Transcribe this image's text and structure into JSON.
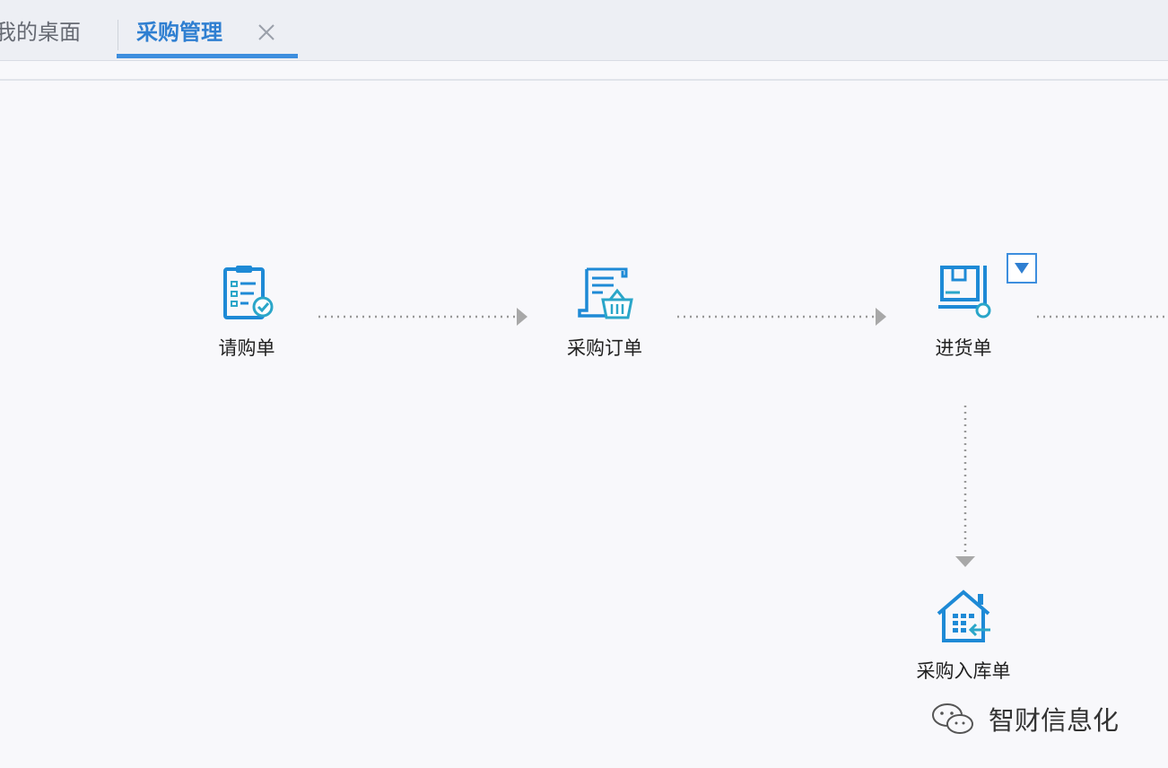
{
  "tabs": {
    "desktop_label": "我的桌面",
    "active_label": "采购管理"
  },
  "flow": {
    "nodes": [
      {
        "label": "请购单",
        "icon": "requisition-form-icon"
      },
      {
        "label": "采购订单",
        "icon": "purchase-order-basket-icon"
      },
      {
        "label": "进货单",
        "icon": "goods-receipt-icon"
      },
      {
        "label": "采购入库单",
        "icon": "warehouse-inbound-icon"
      }
    ]
  },
  "watermark": {
    "text": "智财信息化",
    "icon": "wechat-icon"
  },
  "colors": {
    "accent": "#2f7fd1",
    "icon_blue": "#1e8ad6",
    "icon_teal": "#2aa6c9"
  }
}
